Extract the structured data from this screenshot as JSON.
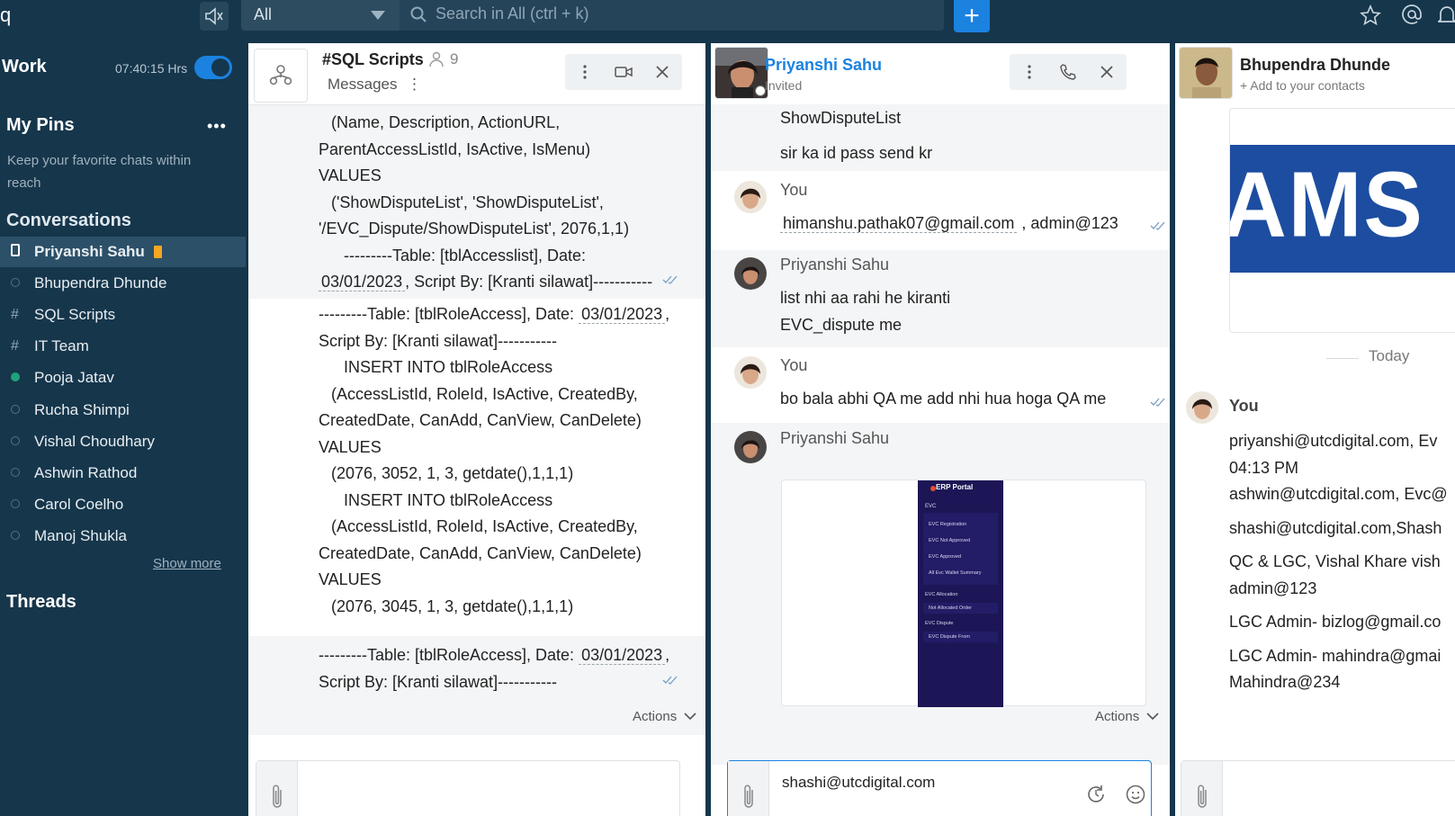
{
  "topbar": {
    "app_glyph": "q",
    "scope": "All",
    "search_placeholder": "Search in All (ctrl + k)",
    "add_label": "+"
  },
  "sidebar": {
    "work_label": "Work",
    "timer": "07:40:15 Hrs",
    "pins_title": "My Pins",
    "pins_more": "•••",
    "pins_hint": "Keep your favorite chats within reach",
    "conversations_title": "Conversations",
    "conversations": [
      {
        "name": "Priyanshi Sahu",
        "type": "phone",
        "active": true,
        "pinned": true
      },
      {
        "name": "Bhupendra Dhunde",
        "type": "offline"
      },
      {
        "name": "SQL Scripts",
        "type": "channel",
        "lead": "#"
      },
      {
        "name": "IT Team",
        "type": "channel",
        "lead": "#"
      },
      {
        "name": "Pooja Jatav",
        "type": "online"
      },
      {
        "name": "Rucha Shimpi",
        "type": "offline"
      },
      {
        "name": "Vishal Choudhary",
        "type": "offline"
      },
      {
        "name": "Ashwin Rathod",
        "type": "offline"
      },
      {
        "name": "Carol Coelho",
        "type": "offline"
      },
      {
        "name": "Manoj Shukla",
        "type": "offline"
      }
    ],
    "show_more": "Show more",
    "threads_title": "Threads"
  },
  "sql_panel": {
    "title": "#SQL Scripts",
    "member_count": "9",
    "tab": "Messages",
    "tab_more": "⋮",
    "lines": {
      "l1": "(Name, Description, ActionURL,",
      "l2": "ParentAccessListId, IsActive, IsMenu)",
      "l3": "VALUES",
      "l4": "('ShowDisputeList', 'ShowDisputeList',",
      "l5": "'/EVC_Dispute/ShowDisputeList', 2076,1,1)",
      "l6": "---------Table: [tblAccesslist], Date:",
      "l7_date": "03/01/2023",
      "l7_rest": ", Script By: [Kranti silawat]-----------",
      "m2_l1_pre": "---------Table: [tblRoleAccess], Date:",
      "m2_l1_date": "03/01/2023",
      "m2_l1_post": ",",
      "m2_l2": "Script By: [Kranti silawat]-----------",
      "m2_l3": "INSERT INTO tblRoleAccess",
      "m2_l4": "(AccessListId, RoleId, IsActive, CreatedBy,",
      "m2_l5": "CreatedDate, CanAdd, CanView, CanDelete)",
      "m2_l6": "VALUES",
      "m2_l7": "(2076, 3052, 1, 3, getdate(),1,1,1)",
      "m2_l8": "INSERT INTO tblRoleAccess",
      "m2_l9": "(AccessListId, RoleId, IsActive, CreatedBy,",
      "m2_l10": "CreatedDate, CanAdd, CanView, CanDelete)",
      "m2_l11": "VALUES",
      "m2_l12": "(2076, 3045, 1, 3, getdate(),1,1,1)",
      "m3_l1_pre": "---------Table: [tblRoleAccess], Date:",
      "m3_l1_date": "03/01/2023",
      "m3_l1_post": ",",
      "m3_l2": "Script By: [Kranti silawat]-----------"
    },
    "actions": "Actions"
  },
  "ps_panel": {
    "name": "Priyanshi Sahu",
    "status": "Invited",
    "messages": {
      "top1": "ShowDisputeList",
      "top2": "sir ka  id pass send kr",
      "you1_sender": "You",
      "you1_email": "himanshu.pathak07@gmail.com",
      "you1_rest": ", admin@123",
      "ps1_sender": "Priyanshi Sahu",
      "ps1_l1": "list nhi aa rahi  he kiranti",
      "ps1_l2": "EVC_dispute me",
      "you2_sender": "You",
      "you2_text": "bo bala abhi QA me add nhi hua hoga QA me",
      "ps2_sender": "Priyanshi Sahu"
    },
    "attachment": {
      "title": "ERP Portal",
      "items": [
        "EVC",
        "EVC Registration",
        "EVC Not Approved",
        "EVC Approved",
        "All Evc Wallet Summary",
        "EVC Allocation",
        "Not Allocated Order",
        "EVC Dispute",
        "EVC Dispute From"
      ]
    },
    "actions": "Actions",
    "composer_text": "shashi@utcdigital.com"
  },
  "bd_panel": {
    "name": "Bhupendra Dhunde",
    "subtitle": "+ Add to your contacts",
    "banner_text": "AMS",
    "today": "Today",
    "sender": "You",
    "lines": {
      "l1": "priyanshi@utcdigital.com,  Ev",
      "l2": "04:13 PM",
      "l3": "ashwin@utcdigital.com, Evc@",
      "l4": "shashi@utcdigital.com,Shash",
      "l5": "QC & LGC, Vishal Khare vish",
      "l6": "admin@123",
      "l7": "LGC Admin- bizlog@gmail.co",
      "l8": "LGC Admin- mahindra@gmai",
      "l9": "Mahindra@234"
    }
  },
  "colors": {
    "sidebar_bg": "#16364b",
    "accent": "#1b82e0",
    "link_blue": "#1b82e0",
    "pin_tag": "#f5a623",
    "online": "#1fa37a"
  },
  "icons": [
    "speaker-icon",
    "search-icon",
    "star-icon",
    "at-icon",
    "bell-icon",
    "members-icon",
    "more-vert-icon",
    "video-icon",
    "close-icon",
    "phone-icon",
    "paperclip-icon",
    "refresh-icon",
    "emoji-icon",
    "chevron-down-icon",
    "double-check-icon"
  ]
}
